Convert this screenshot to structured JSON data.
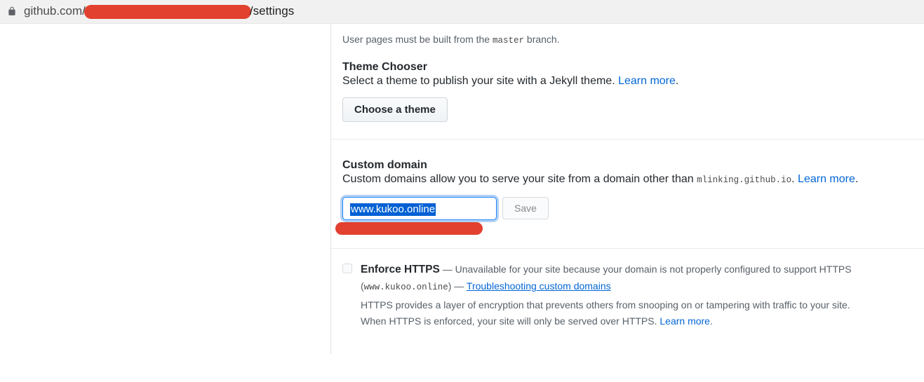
{
  "url": {
    "prefix": "github.com/",
    "suffix": "/settings"
  },
  "pages": {
    "note_prefix": "User pages must be built from the ",
    "note_branch": "master",
    "note_suffix": " branch."
  },
  "theme": {
    "title": "Theme Chooser",
    "desc_prefix": "Select a theme to publish your site with a Jekyll theme. ",
    "learn_more": "Learn more",
    "button": "Choose a theme"
  },
  "custom_domain": {
    "title": "Custom domain",
    "desc_prefix": "Custom domains allow you to serve your site from a domain other than ",
    "default_domain": "mlinking.github.io",
    "learn_more": "Learn more",
    "input_value": "www.kukoo.online",
    "save": "Save"
  },
  "https": {
    "title": "Enforce HTTPS",
    "dash": " — ",
    "status": "Unavailable for your site because your domain is not properly configured to support HTTPS",
    "paren_open": "(",
    "domain_code": "www.kukoo.online",
    "paren_close_dash": ") — ",
    "troubleshoot": "Troubleshooting custom domains",
    "line1": "HTTPS provides a layer of encryption that prevents others from snooping on or tampering with traffic to your site.",
    "line2_prefix": "When HTTPS is enforced, your site will only be served over HTTPS. ",
    "learn_more": "Learn more"
  }
}
